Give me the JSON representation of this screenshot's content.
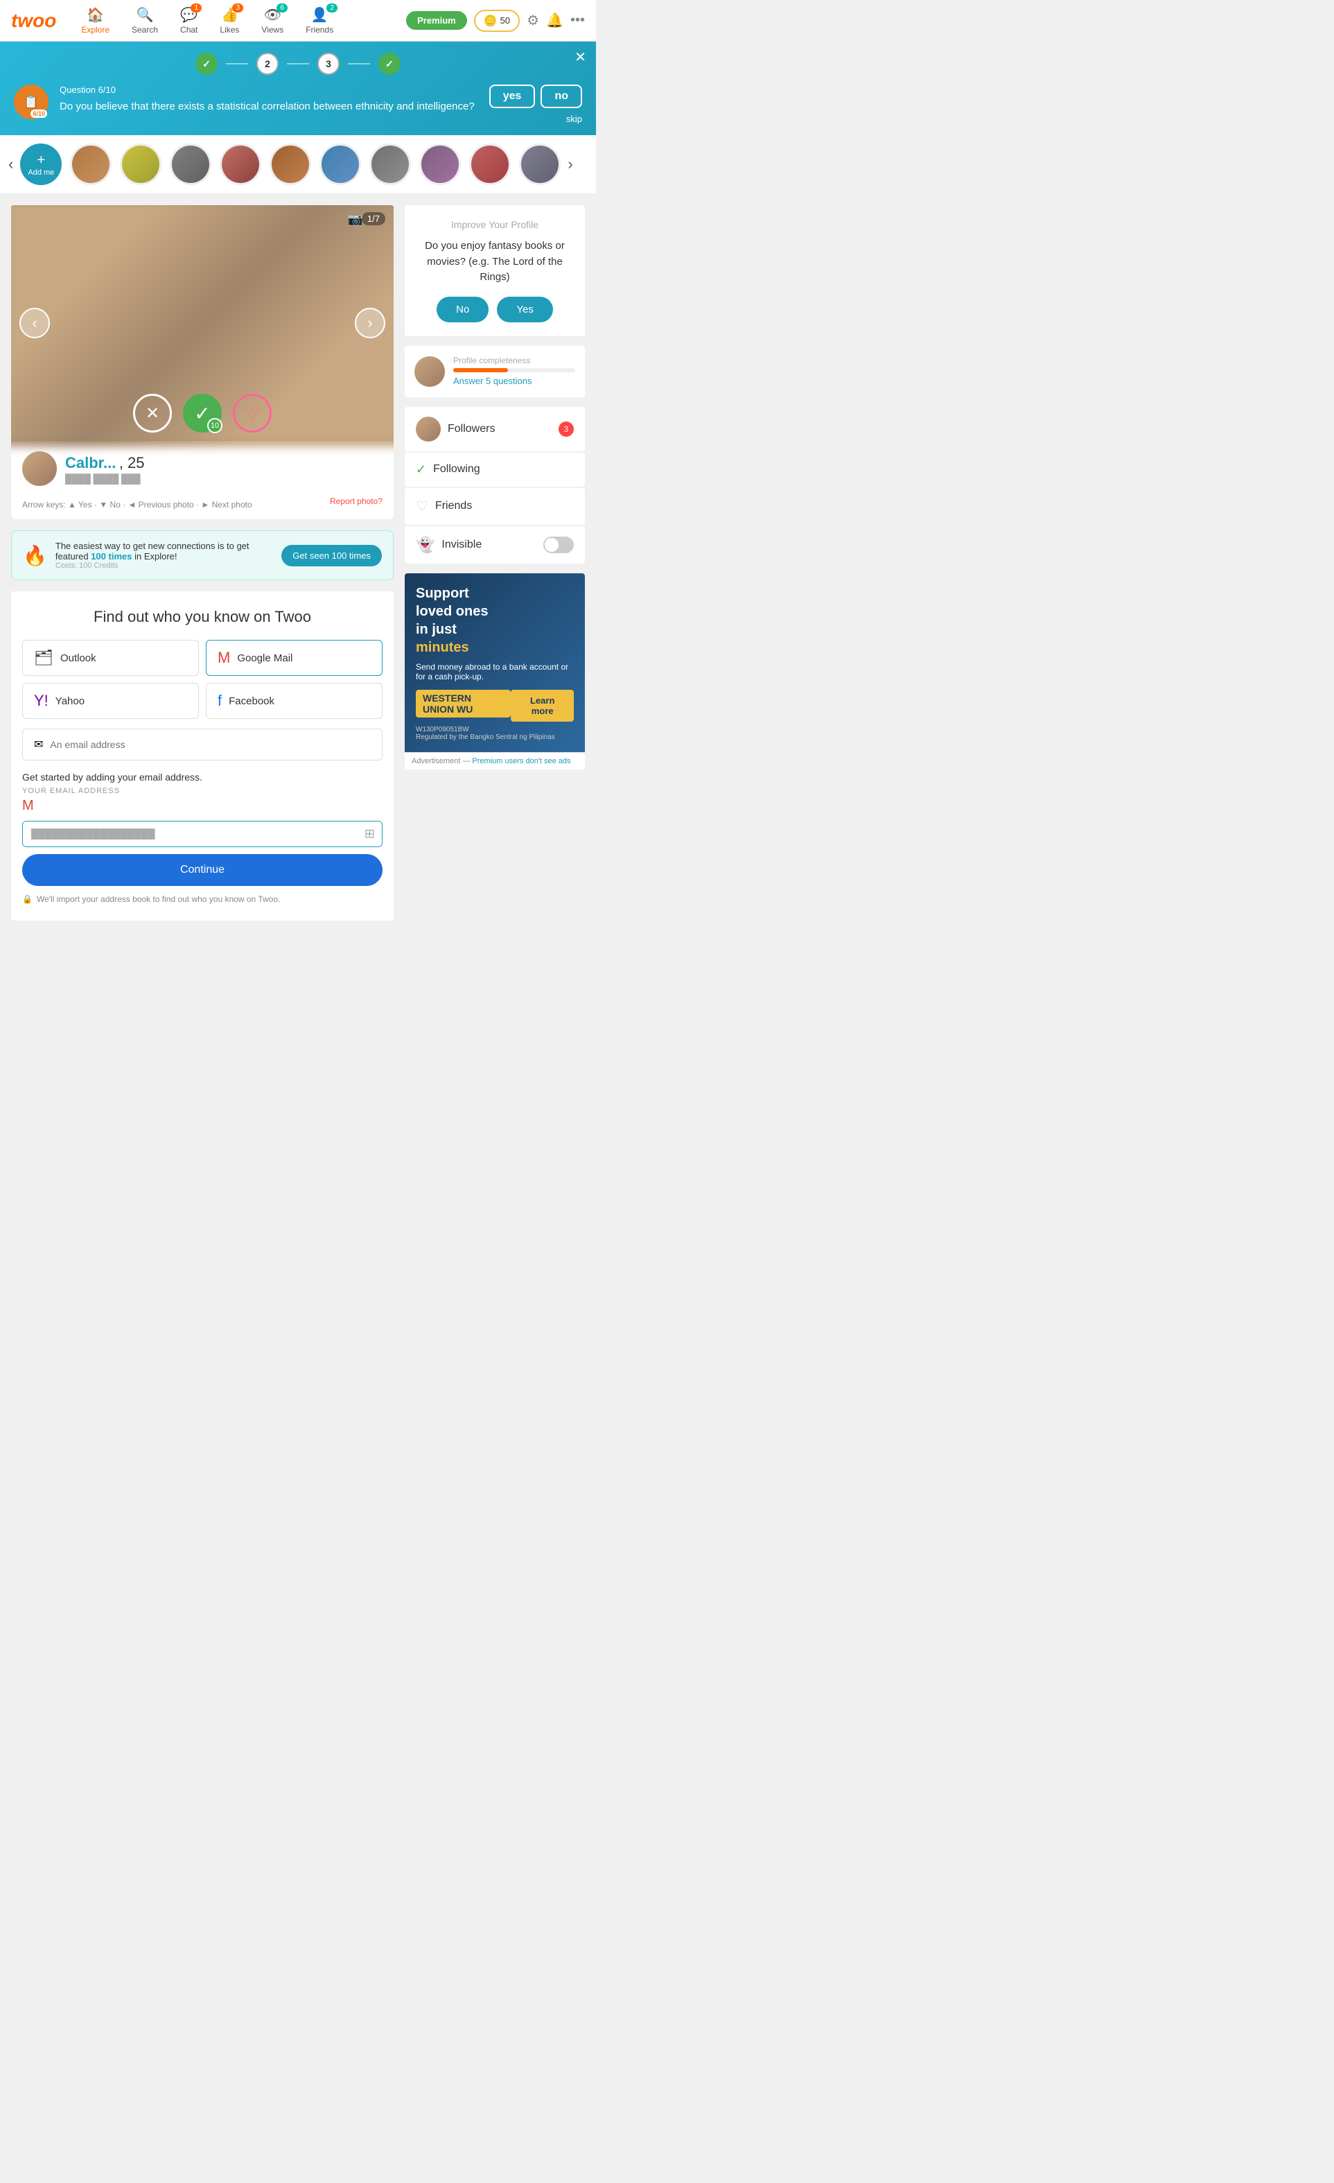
{
  "app": {
    "logo": "twoo",
    "nav": {
      "explore": {
        "label": "Explore",
        "icon": "🏠",
        "active": true
      },
      "search": {
        "label": "Search",
        "icon": "🔍"
      },
      "chat": {
        "label": "Chat",
        "icon": "💬",
        "badge": "1",
        "badge_color": "orange"
      },
      "likes": {
        "label": "Likes",
        "icon": "👍",
        "badge": "3",
        "badge_color": "orange"
      },
      "views": {
        "label": "Views",
        "icon": "👁",
        "badge": "6",
        "badge_color": "teal"
      },
      "friends": {
        "label": "Friends",
        "icon": "👤",
        "badge": "2",
        "badge_color": "teal"
      }
    },
    "premium_btn": "Premium",
    "coins": "50"
  },
  "quiz": {
    "title": "Question 6/10",
    "question": "Do you believe that there exists a statistical correlation between ethnicity and intelligence?",
    "steps": [
      "done",
      "2",
      "3",
      "done"
    ],
    "yes_label": "yes",
    "no_label": "no",
    "skip_label": "skip"
  },
  "stories": {
    "add_me": "+\nAdd me",
    "arrow_left": "‹",
    "arrow_right": "›"
  },
  "photo_viewer": {
    "counter": "1/7",
    "prev_btn": "‹",
    "next_btn": "›",
    "profile_name": "Calbr...",
    "profile_age": "25",
    "profile_location": "████ ████ ███",
    "arrow_keys_text": "Arrow keys:  ▲  Yes · ▼  No · ◄  Previous photo · ►  Next photo",
    "report_link": "Report photo?"
  },
  "boost": {
    "text": "The easiest way to get new connections is to get featured",
    "highlight": "100 times",
    "text2": "in Explore!",
    "cost": "Costs: 100 Credits",
    "btn": "Get seen 100 times"
  },
  "find_friends": {
    "title": "Find out who you know on Twoo",
    "outlook": "Outlook",
    "google_mail": "Google Mail",
    "yahoo": "Yahoo",
    "facebook": "Facebook",
    "email_placeholder": "An email address",
    "get_started": "Get started by adding your email address.",
    "email_label": "YOUR EMAIL ADDRESS",
    "email_value": "██████████████████",
    "continue_btn": "Continue",
    "privacy_note": "We'll import your address book to find out who you know on Twoo."
  },
  "right_panel": {
    "improve_title": "Improve Your Profile",
    "improve_question": "Do you enjoy fantasy books or movies? (e.g. The Lord of the Rings)",
    "no_btn": "No",
    "yes_btn": "Yes",
    "completeness_label": "Profile completeness",
    "completeness_link": "Answer 5 questions",
    "followers_label": "Followers",
    "followers_badge": "3",
    "following_label": "Following",
    "friends_label": "Friends",
    "invisible_label": "Invisible"
  },
  "ad": {
    "title_line1": "Support",
    "title_line2": "loved ones",
    "title_line3": "in just",
    "highlight": "minutes",
    "desc": "Send money abroad to a bank account or for a cash pick-up.",
    "logo": "WESTERN\nUNION WU",
    "btn": "Learn more",
    "code": "W130P09051BW",
    "regulated": "Regulated by the Bangko Sentral ng Pilipinas",
    "footer": "Advertisement — Premium users don't see ads"
  }
}
